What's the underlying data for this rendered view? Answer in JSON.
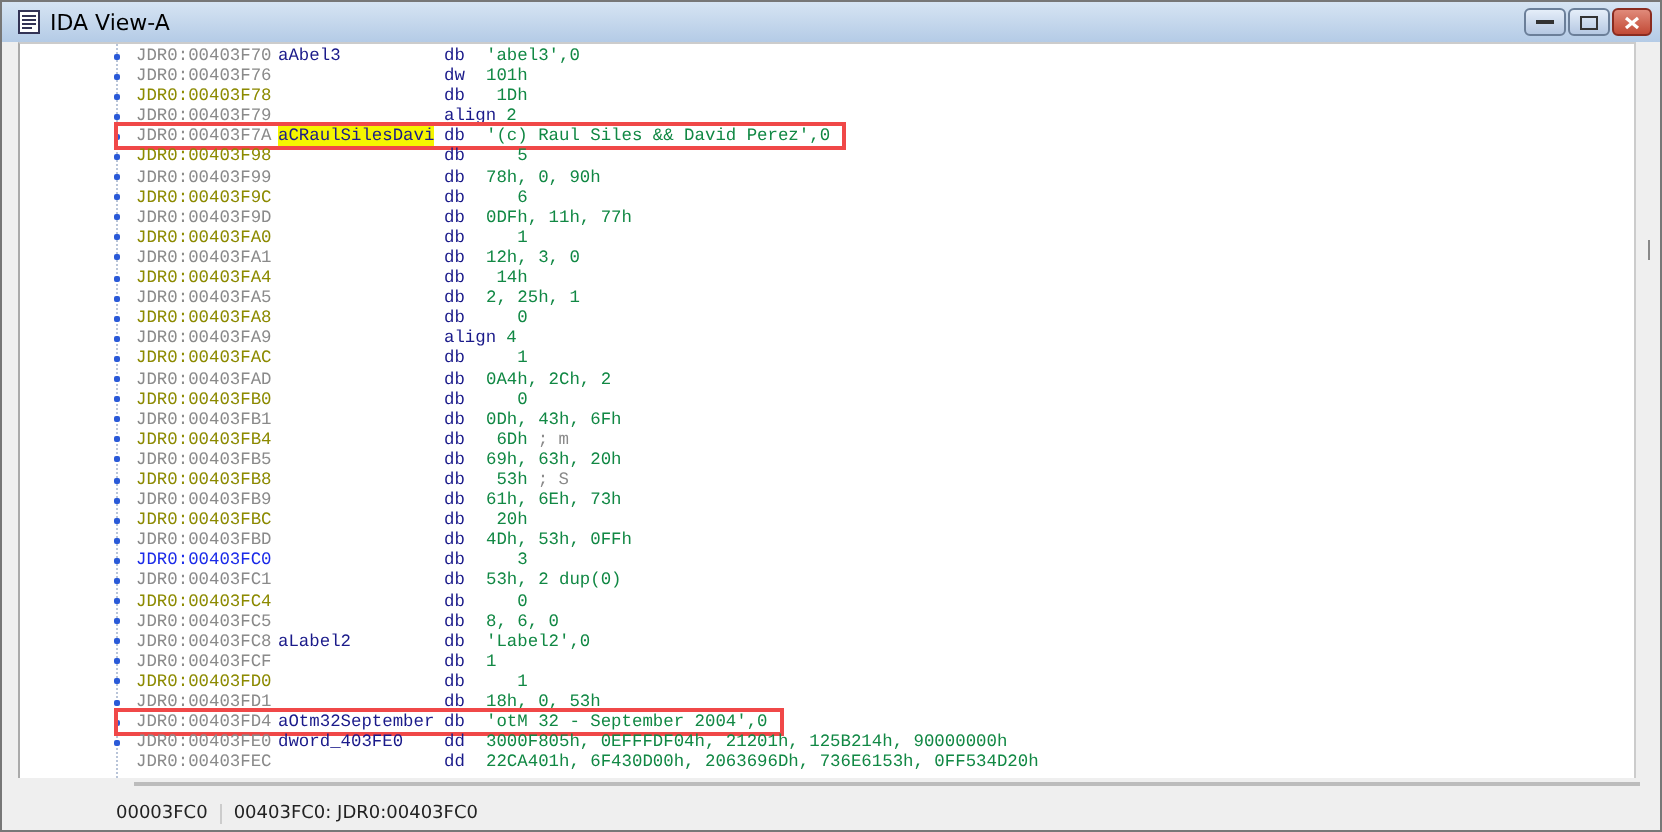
{
  "window": {
    "title": "IDA View-A"
  },
  "rows": [
    {
      "address": "JDR0:00403F70",
      "kind": "plain",
      "bullet": true,
      "label": {
        "text": "aAbel3",
        "selected": false
      },
      "mnemonic": "db",
      "operands": "'abel3',0",
      "annotated": false
    },
    {
      "address": "JDR0:00403F76",
      "kind": "plain",
      "bullet": true,
      "mnemonic": "dw",
      "operands": "101h",
      "annotated": false
    },
    {
      "address": "JDR0:00403F78",
      "kind": "referenced",
      "bullet": true,
      "mnemonic": "db",
      "operands": " 1Dh",
      "annotated": false
    },
    {
      "address": "JDR0:00403F79",
      "kind": "plain",
      "bullet": true,
      "mnemonic": "align",
      "operands": "2",
      "annotated": false
    },
    {
      "address": "JDR0:00403F7A",
      "kind": "plain",
      "bullet": true,
      "label": {
        "text": "aCRaulSilesDavi",
        "selected": true
      },
      "mnemonic": "db",
      "operands": "'(c) Raul Siles && David Perez',0",
      "annotated": true
    },
    {
      "address": "JDR0:00403F98",
      "kind": "referenced",
      "bullet": true,
      "mnemonic": "db",
      "operands": "   5",
      "annotated": false
    },
    {
      "address": "JDR0:00403F99",
      "kind": "plain",
      "bullet": true,
      "mnemonic": "db",
      "operands": "78h, 0, 90h",
      "annotated": false
    },
    {
      "address": "JDR0:00403F9C",
      "kind": "referenced",
      "bullet": true,
      "mnemonic": "db",
      "operands": "   6",
      "annotated": false
    },
    {
      "address": "JDR0:00403F9D",
      "kind": "plain",
      "bullet": true,
      "mnemonic": "db",
      "operands": "0DFh, 11h, 77h",
      "annotated": false
    },
    {
      "address": "JDR0:00403FA0",
      "kind": "referenced",
      "bullet": true,
      "mnemonic": "db",
      "operands": "   1",
      "annotated": false
    },
    {
      "address": "JDR0:00403FA1",
      "kind": "plain",
      "bullet": true,
      "mnemonic": "db",
      "operands": "12h, 3, 0",
      "annotated": false
    },
    {
      "address": "JDR0:00403FA4",
      "kind": "referenced",
      "bullet": true,
      "mnemonic": "db",
      "operands": " 14h",
      "annotated": false
    },
    {
      "address": "JDR0:00403FA5",
      "kind": "plain",
      "bullet": true,
      "mnemonic": "db",
      "operands": "2, 25h, 1",
      "annotated": false
    },
    {
      "address": "JDR0:00403FA8",
      "kind": "referenced",
      "bullet": true,
      "mnemonic": "db",
      "operands": "   0",
      "annotated": false
    },
    {
      "address": "JDR0:00403FA9",
      "kind": "plain",
      "bullet": true,
      "mnemonic": "align",
      "operands": "4",
      "annotated": false
    },
    {
      "address": "JDR0:00403FAC",
      "kind": "referenced",
      "bullet": true,
      "mnemonic": "db",
      "operands": "   1",
      "annotated": false
    },
    {
      "address": "JDR0:00403FAD",
      "kind": "plain",
      "bullet": true,
      "mnemonic": "db",
      "operands": "0A4h, 2Ch, 2",
      "annotated": false
    },
    {
      "address": "JDR0:00403FB0",
      "kind": "referenced",
      "bullet": true,
      "mnemonic": "db",
      "operands": "   0",
      "annotated": false
    },
    {
      "address": "JDR0:00403FB1",
      "kind": "plain",
      "bullet": true,
      "mnemonic": "db",
      "operands": "0Dh, 43h, 6Fh",
      "annotated": false
    },
    {
      "address": "JDR0:00403FB4",
      "kind": "referenced",
      "bullet": true,
      "mnemonic": "db",
      "operands": " 6Dh",
      "comment": "; m",
      "annotated": false
    },
    {
      "address": "JDR0:00403FB5",
      "kind": "plain",
      "bullet": true,
      "mnemonic": "db",
      "operands": "69h, 63h, 20h",
      "annotated": false
    },
    {
      "address": "JDR0:00403FB8",
      "kind": "referenced",
      "bullet": true,
      "mnemonic": "db",
      "operands": " 53h",
      "comment": "; S",
      "annotated": false
    },
    {
      "address": "JDR0:00403FB9",
      "kind": "plain",
      "bullet": true,
      "mnemonic": "db",
      "operands": "61h, 6Eh, 73h",
      "annotated": false
    },
    {
      "address": "JDR0:00403FBC",
      "kind": "referenced",
      "bullet": true,
      "mnemonic": "db",
      "operands": " 20h",
      "annotated": false
    },
    {
      "address": "JDR0:00403FBD",
      "kind": "plain",
      "bullet": true,
      "mnemonic": "db",
      "operands": "4Dh, 53h, 0FFh",
      "annotated": false
    },
    {
      "address": "JDR0:00403FC0",
      "kind": "current",
      "bullet": true,
      "mnemonic": "db",
      "operands": "   3",
      "annotated": false
    },
    {
      "address": "JDR0:00403FC1",
      "kind": "plain",
      "bullet": true,
      "mnemonic": "db",
      "operands": "53h, 2 dup(0)",
      "annotated": false
    },
    {
      "address": "JDR0:00403FC4",
      "kind": "referenced",
      "bullet": true,
      "mnemonic": "db",
      "operands": "   0",
      "annotated": false
    },
    {
      "address": "JDR0:00403FC5",
      "kind": "plain",
      "bullet": true,
      "mnemonic": "db",
      "operands": "8, 6, 0",
      "annotated": false
    },
    {
      "address": "JDR0:00403FC8",
      "kind": "plain",
      "bullet": true,
      "label": {
        "text": "aLabel2",
        "selected": false
      },
      "mnemonic": "db",
      "operands": "'Label2',0",
      "annotated": false
    },
    {
      "address": "JDR0:00403FCF",
      "kind": "plain",
      "bullet": true,
      "mnemonic": "db",
      "operands": "1",
      "annotated": false
    },
    {
      "address": "JDR0:00403FD0",
      "kind": "referenced",
      "bullet": true,
      "mnemonic": "db",
      "operands": "   1",
      "annotated": false
    },
    {
      "address": "JDR0:00403FD1",
      "kind": "plain",
      "bullet": true,
      "mnemonic": "db",
      "operands": "18h, 0, 53h",
      "annotated": false
    },
    {
      "address": "JDR0:00403FD4",
      "kind": "plain",
      "bullet": true,
      "label": {
        "text": "aOtm32September",
        "selected": false
      },
      "mnemonic": "db",
      "operands": "'otM 32 - September 2004',0",
      "annotated": true
    },
    {
      "address": "JDR0:00403FE0",
      "kind": "plain",
      "bullet": true,
      "label": {
        "text": "dword_403FE0",
        "selected": false
      },
      "mnemonic": "dd",
      "operands": "3000F805h, 0EFFFDF04h, 21201h, 125B214h, 90000000h",
      "annotated": false
    },
    {
      "address": "JDR0:00403FEC",
      "kind": "plain",
      "bullet": false,
      "mnemonic": "dd",
      "operands": "22CA401h, 6F430D00h, 2063696Dh, 736E6153h, 0FF534D20h",
      "annotated": false
    }
  ],
  "status_bar": {
    "offset": "00003FC0",
    "location": "00403FC0: JDR0:00403FC0"
  }
}
